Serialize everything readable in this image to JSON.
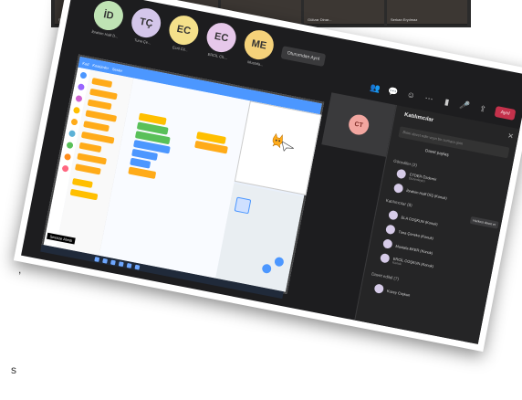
{
  "top_strip": {
    "tiles": [
      "Şeyda",
      "Emre Yıldırım D...",
      "Orhan Karar Kılıç",
      "Gülizar Dinar...",
      "Serkan Eryılmaz"
    ]
  },
  "background_text": {
    "left_char": ",",
    "right_char": "s"
  },
  "meeting": {
    "participants": [
      {
        "initials": "İD",
        "name": "İbrahim Halil D...",
        "color": "#bfe3b4"
      },
      {
        "initials": "TÇ",
        "name": "Tuna Çe...",
        "color": "#d4c6ea"
      },
      {
        "initials": "EC",
        "name": "Ecril Cil...",
        "color": "#f4e08a"
      },
      {
        "initials": "EC",
        "name": "ERCİL CİL...",
        "color": "#e6c8ea"
      },
      {
        "initials": "ME",
        "name": "Mustafa...",
        "color": "#f5d27a"
      }
    ],
    "leave_label": "Oturumdan Ayrıl",
    "toolbar": {
      "people_count": "19",
      "leave_button": "Ayrıl"
    },
    "self_tile": {
      "initials": "CT"
    }
  },
  "scratch": {
    "tabs": [
      "Kod",
      "Kostümler",
      "Sesler"
    ],
    "category_colors": [
      "#4c97ff",
      "#9966ff",
      "#cf63cf",
      "#ffbf00",
      "#ffab19",
      "#5cb1d6",
      "#59c059",
      "#ff8c1a",
      "#ff6680"
    ],
    "mute_badge": "Sessize Alındı"
  },
  "panel": {
    "title": "Katılımcılar",
    "search_placeholder": "Birini davet edin veya bir numara girin",
    "share_link": "Davet paylaş",
    "invite_all": "Herkesi davet et",
    "sections": [
      {
        "label": "Görevliler (2)"
      },
      {
        "label": "Katılımcılar (8)"
      },
      {
        "label": "Davet edildi (7)"
      }
    ],
    "members": [
      {
        "name": "CTDER Özdemir",
        "sub": "Düzenleyici"
      },
      {
        "name": "İbrahim Halil DİŞ (Konuk)",
        "sub": ""
      },
      {
        "name": "ELA COŞKUN (Konuk)",
        "sub": ""
      },
      {
        "name": "Tuna Çeneko (Konuk)",
        "sub": ""
      },
      {
        "name": "Mustafa EKER (Konuk)",
        "sub": ""
      },
      {
        "name": "ERCİL COŞKUN (Konuk)",
        "sub": "Konuk"
      },
      {
        "name": "Kuzey Coşkun",
        "sub": ""
      }
    ]
  }
}
